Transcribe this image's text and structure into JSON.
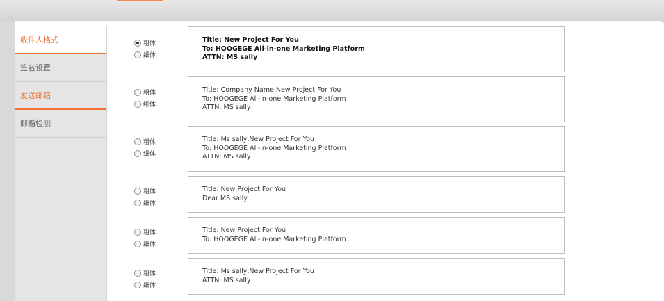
{
  "sidebar": {
    "items": [
      {
        "label": "收件人格式"
      },
      {
        "label": "签名设置"
      },
      {
        "label": "发送邮箱"
      },
      {
        "label": "邮箱检测"
      }
    ]
  },
  "radio_labels": {
    "bold": "粗体",
    "thin": "细体"
  },
  "formats": [
    {
      "lines": [
        "Title: New Project For You",
        "To: HOOGEGE All-in-one Marketing Platform",
        "ATTN: MS sally"
      ],
      "selected": "bold"
    },
    {
      "lines": [
        "Title: Company Name,New Project For You",
        "To: HOOGEGE All-in-one Marketing Platform",
        "ATTN: MS sally"
      ],
      "selected": null
    },
    {
      "lines": [
        "Title: Ms sally,New Project For You",
        "To: HOOGEGE All-in-one Marketing Platform",
        "ATTN: MS sally"
      ],
      "selected": null
    },
    {
      "lines": [
        "Title: New Project For You",
        "Dear MS sally"
      ],
      "selected": null
    },
    {
      "lines": [
        "Title: New Project For You",
        "To: HOOGEGE All-in-one Marketing Platform"
      ],
      "selected": null
    },
    {
      "lines": [
        "Title: Ms sally,New Project For You",
        "ATTN: MS sally"
      ],
      "selected": null
    }
  ],
  "colors": {
    "accent": "#f07030",
    "sidebar_bg": "#e5e5e5",
    "border": "#bdbdbd"
  }
}
